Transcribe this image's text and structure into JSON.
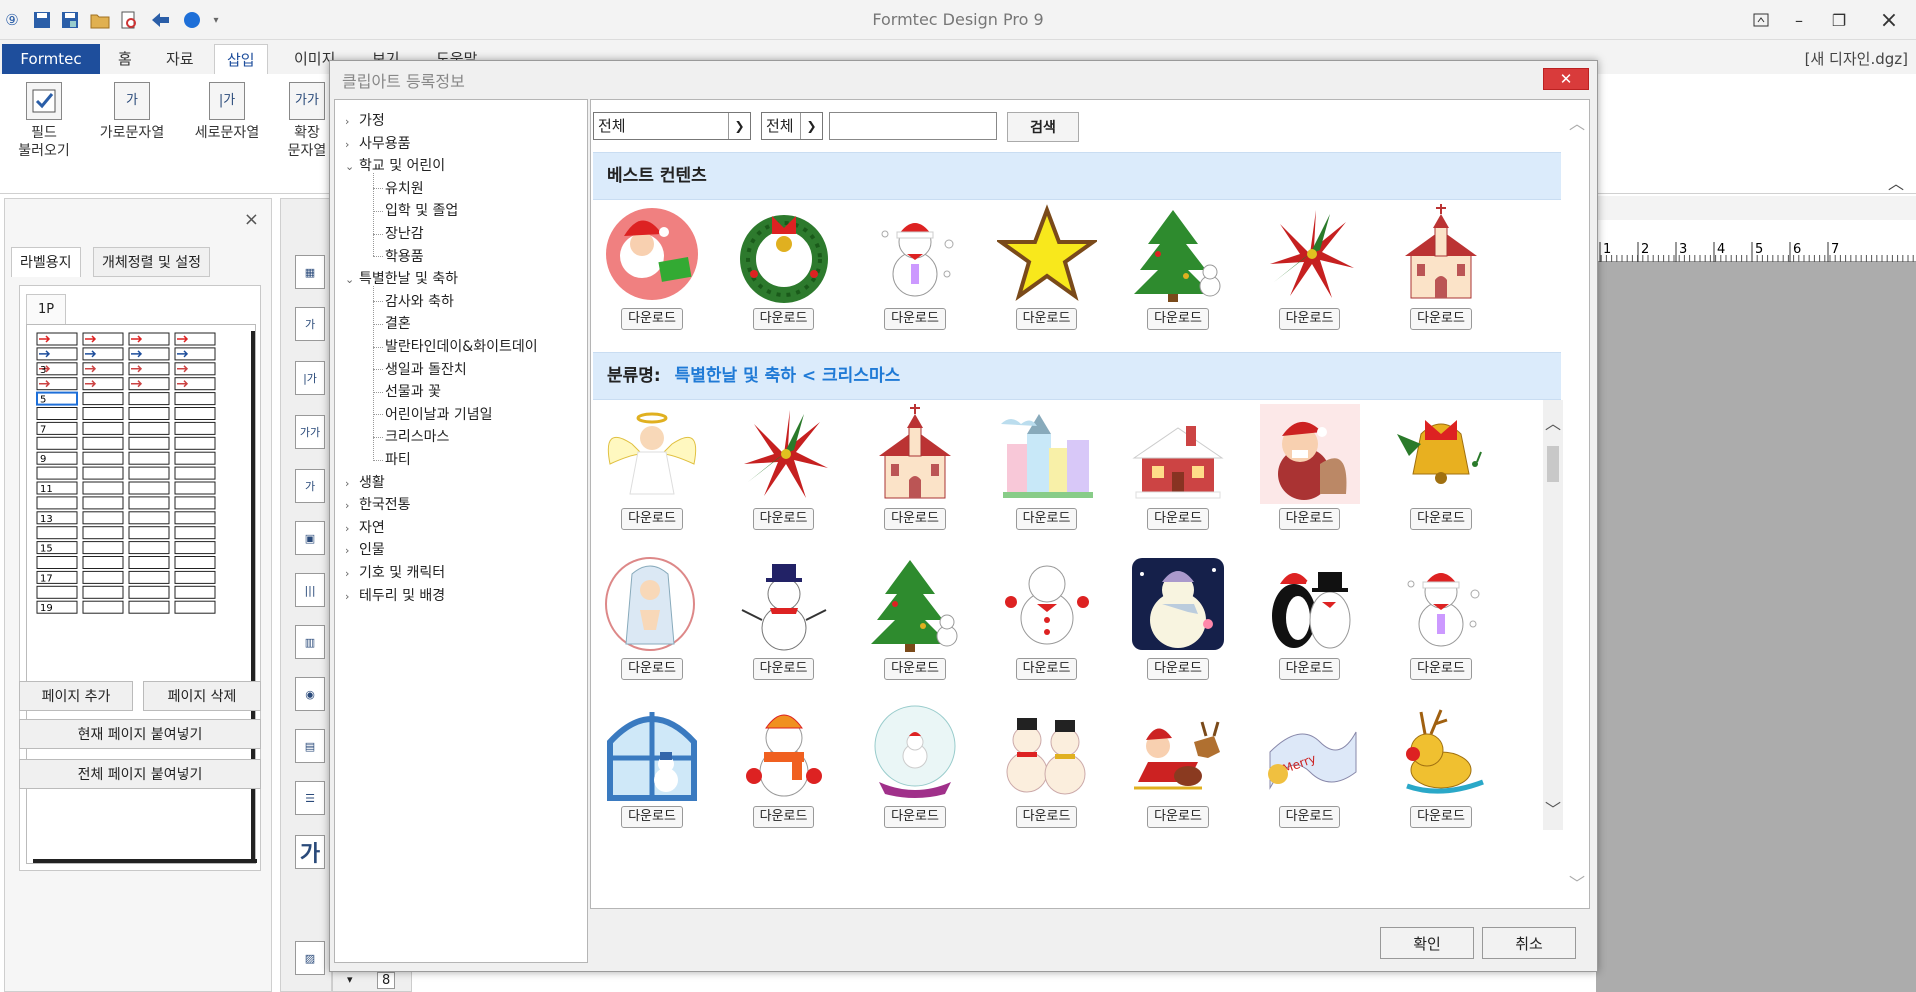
{
  "app": {
    "title": "Formtec Design Pro 9",
    "file_name": "[새 디자인.dgz]"
  },
  "ribbon": {
    "tabs": [
      "Formtec",
      "홈",
      "자료",
      "삽입",
      "이미지",
      "보기",
      "도움말"
    ],
    "buttons": [
      {
        "icon_text": "",
        "label1": "필드",
        "label2": "불러오기"
      },
      {
        "icon_text": "가",
        "label1": "가로문자열",
        "label2": ""
      },
      {
        "icon_text": "|가",
        "label1": "세로문자열",
        "label2": ""
      },
      {
        "icon_text": "가가",
        "label1": "확장",
        "label2": "문자열"
      }
    ]
  },
  "left_panel": {
    "tabs": [
      "라벨용지",
      "개체정렬 및 설정"
    ],
    "page_tab": "1P",
    "row_numbers": [
      "3",
      "5",
      "7",
      "9",
      "11",
      "13",
      "15",
      "17",
      "19"
    ],
    "add_page": "페이지 추가",
    "delete_page": "페이지 삭제",
    "paste_current": "현재 페이지 붙여넣기",
    "paste_all": "전체 페이지 붙여넣기"
  },
  "ruler": [
    "1",
    "2",
    "3",
    "4",
    "5",
    "6",
    "7"
  ],
  "page_field": "8",
  "dialog": {
    "title": "클립아트 등록정보",
    "category_select": "전체",
    "field_select": "전체",
    "search_value": "",
    "search_button": "검색",
    "best_header": "베스트 컨텐츠",
    "category_label": "분류명:",
    "category_path": "특별한날 및 축하 < 크리스마스",
    "download_label": "다운로드",
    "ok_button": "확인",
    "cancel_button": "취소",
    "tree": [
      {
        "label": "가정",
        "level": 0,
        "expanded": false
      },
      {
        "label": "사무용품",
        "level": 0,
        "expanded": false
      },
      {
        "label": "학교 및 어린이",
        "level": 0,
        "expanded": true
      },
      {
        "label": "유치원",
        "level": 1
      },
      {
        "label": "입학 및 졸업",
        "level": 1
      },
      {
        "label": "장난감",
        "level": 1
      },
      {
        "label": "학용품",
        "level": 1
      },
      {
        "label": "특별한날 및 축하",
        "level": 0,
        "expanded": true
      },
      {
        "label": "감사와 축하",
        "level": 1
      },
      {
        "label": "결혼",
        "level": 1
      },
      {
        "label": "발란타인데이&화이트데이",
        "level": 1
      },
      {
        "label": "생일과 돌잔치",
        "level": 1
      },
      {
        "label": "선물과 꽃",
        "level": 1
      },
      {
        "label": "어린이날과 기념일",
        "level": 1
      },
      {
        "label": "크리스마스",
        "level": 1
      },
      {
        "label": "파티",
        "level": 1
      },
      {
        "label": "생활",
        "level": 0,
        "expanded": false
      },
      {
        "label": "한국전통",
        "level": 0,
        "expanded": false
      },
      {
        "label": "자연",
        "level": 0,
        "expanded": false
      },
      {
        "label": "인물",
        "level": 0,
        "expanded": false
      },
      {
        "label": "기호 및 캐릭터",
        "level": 0,
        "expanded": false
      },
      {
        "label": "테두리 및 배경",
        "level": 0,
        "expanded": false
      }
    ],
    "best_items": [
      "santa-clipart",
      "wreath-clipart",
      "snowman-clipart",
      "star-clipart",
      "tree-clipart",
      "poinsettia-clipart",
      "church-clipart"
    ],
    "category_items": [
      [
        "angel-clipart",
        "poinsettia-clipart",
        "church-clipart",
        "town-clipart",
        "snow-house-clipart",
        "santa-bag-clipart",
        "bell-clipart"
      ],
      [
        "mary-clipart",
        "snowman-hat-clipart",
        "tree-clipart",
        "snowman-dance-clipart",
        "snowman-night-clipart",
        "penguin-clipart",
        "snowman-clipart"
      ],
      [
        "window-clipart",
        "snowman-scarf-clipart",
        "snowglobe-clipart",
        "snowmen-family-clipart",
        "sleigh-clipart",
        "banner-clipart",
        "reindeer-clipart"
      ]
    ]
  },
  "colors": {
    "formtec_blue": "#1e4e9c",
    "close_red": "#d93b3b",
    "band_bg": "#dbebfb",
    "accent_blue": "#1f7ad6"
  }
}
